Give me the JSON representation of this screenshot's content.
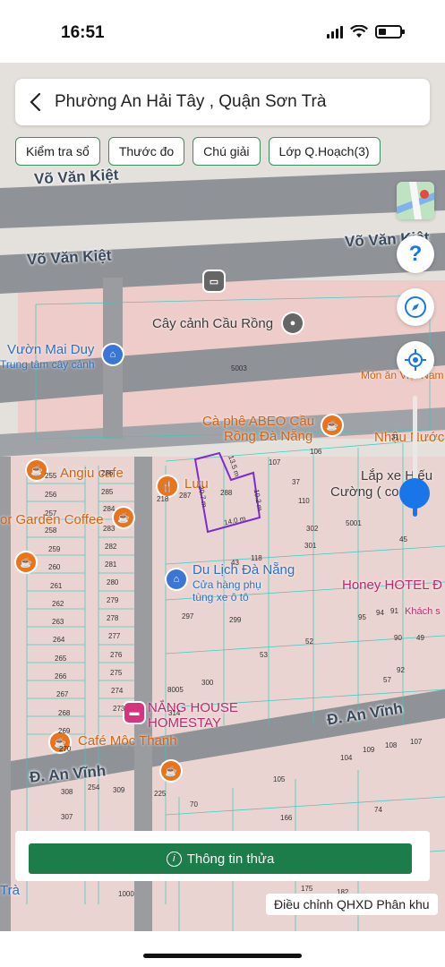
{
  "status": {
    "time": "16:51"
  },
  "header": {
    "title": "Phường An Hải Tây , Quận Sơn Trà"
  },
  "chips": [
    "Kiểm tra sổ",
    "Thước đo",
    "Chú giải",
    "Lớp Q.Hoạch(3)"
  ],
  "streets": [
    "Võ Văn Kiệt",
    "Võ Văn Kiệt",
    "Võ Văn Kiệt",
    "Đ. An Vĩnh",
    "Đ. An Vĩnh"
  ],
  "pois": {
    "vuon_mai_duy": "Vườn Mai Duy",
    "vuon_mai_duy_sub": "Trung tâm cây cảnh",
    "cay_canh": "Cây cảnh Cầu Rồng",
    "mon_an": "Món ăn Việt Nam",
    "abeo_1": "Cà phê ABEO Cầu",
    "abeo_2": "Rồng Đà Nẵng",
    "nhang_nuoc": "Nhậu Nước",
    "lap_xe_1": "Lắp xe Hiếu",
    "lap_xe_2": "Cường ( co...",
    "angiu": "Angiu cafe",
    "garden": "or Garden Coffee",
    "luu": "Lưu",
    "du_lich": "Du Lịch Đà Nẵng",
    "du_lich_sub_1": "Cửa hàng phụ",
    "du_lich_sub_2": "tùng xe ô tô",
    "honey": "Honey HOTEL Đ",
    "khach_s": "Khách s",
    "nang_house_1": "NẮNG HOUSE",
    "nang_house_2": "HOMESTAY",
    "moc_thanh": "Café Mộc Thanh",
    "tra": "Trà"
  },
  "lot_numbers": [
    "5003",
    "106",
    "107",
    "37",
    "110",
    "288",
    "218",
    "287",
    "43",
    "118",
    "302",
    "5001",
    "301",
    "45",
    "31",
    "255",
    "256",
    "257",
    "258",
    "259",
    "260",
    "261",
    "262",
    "263",
    "264",
    "265",
    "266",
    "267",
    "268",
    "269",
    "270",
    "286",
    "285",
    "284",
    "283",
    "282",
    "281",
    "280",
    "279",
    "278",
    "277",
    "276",
    "275",
    "274",
    "273",
    "314",
    "297",
    "299",
    "300",
    "8005",
    "53",
    "52",
    "57",
    "92",
    "95",
    "94",
    "91",
    "90",
    "49",
    "104",
    "109",
    "108",
    "107",
    "105",
    "308",
    "254",
    "309",
    "307",
    "225",
    "70",
    "166",
    "74",
    "1000",
    "175",
    "182"
  ],
  "measurements": [
    "13.5 m",
    "20.7 m",
    "14.0 m",
    "10.2 m"
  ],
  "bottom": {
    "button": "Thông tin thửa",
    "plan": "Điều chỉnh QHXD Phân khu"
  },
  "icons": [
    "back-icon",
    "help-icon",
    "compass-icon",
    "locate-icon",
    "layer-map-icon",
    "info-icon",
    "cafe-icon",
    "restaurant-icon",
    "shop-icon",
    "bus-icon",
    "landmark-icon",
    "hotel-icon"
  ],
  "colors": {
    "accent_green": "#1c7c4a",
    "chip_border": "#3c8f5c",
    "plan_pink": "#f3c9c9",
    "parcel_line": "#3cc7c0",
    "selected_parcel": "#7b2bd0",
    "slider_blue": "#1976e8",
    "road": "#8a8d92"
  }
}
